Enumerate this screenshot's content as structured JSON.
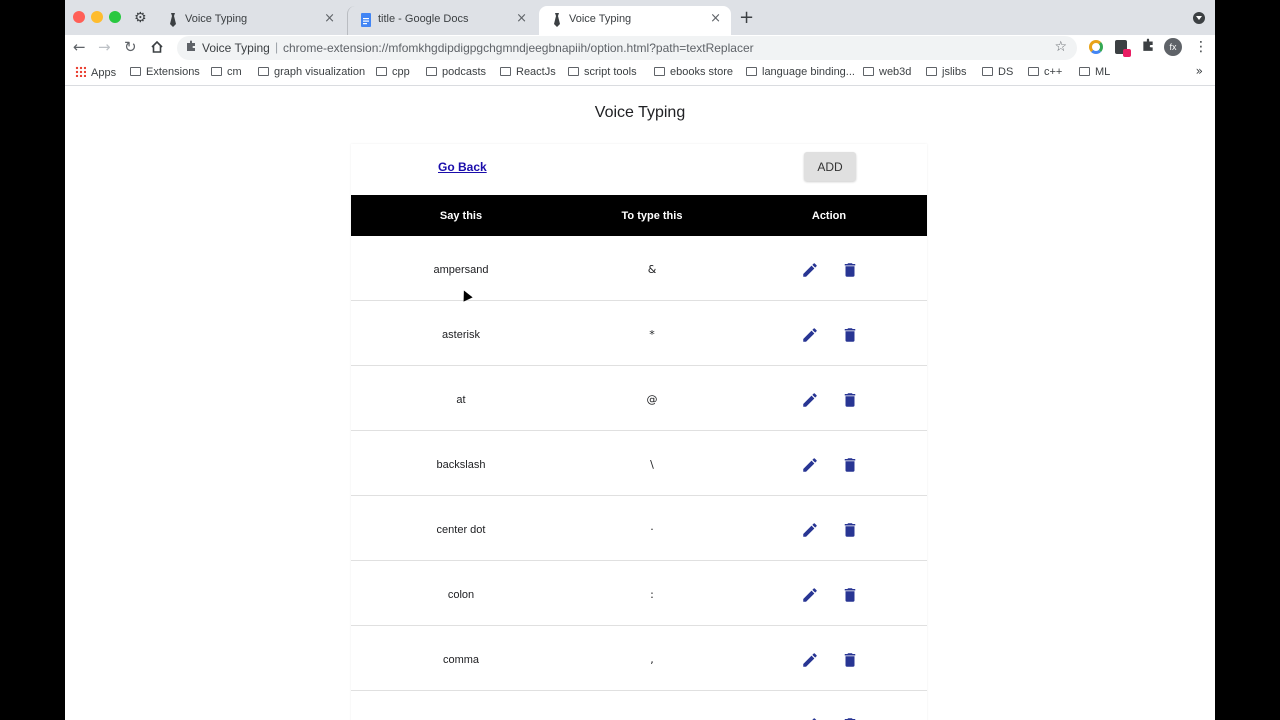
{
  "tabs": [
    {
      "title": "Voice Typing",
      "active": false
    },
    {
      "title": "title - Google Docs",
      "active": false
    },
    {
      "title": "Voice Typing",
      "active": true
    }
  ],
  "omnibox": {
    "site_label": "Voice Typing",
    "url": "chrome-extension://mfomkhgdipdigpgchgmndjeegbnapiih/option.html?path=textReplacer"
  },
  "profile_initials": "fx",
  "bookmarks": [
    "Apps",
    "Extensions",
    "cm",
    "graph visualization",
    "cpp",
    "podcasts",
    "ReactJs",
    "script tools",
    "ebooks store",
    "language binding...",
    "web3d",
    "jslibs",
    "DS",
    "c++",
    "ML"
  ],
  "page": {
    "title": "Voice Typing",
    "go_back": "Go Back",
    "add_label": "ADD",
    "columns": [
      "Say this",
      "To type this",
      "Action"
    ],
    "rows": [
      {
        "say": "ampersand",
        "type": "&"
      },
      {
        "say": "asterisk",
        "type": "*"
      },
      {
        "say": "at",
        "type": "@"
      },
      {
        "say": "backslash",
        "type": "\\"
      },
      {
        "say": "center dot",
        "type": "·"
      },
      {
        "say": "colon",
        "type": ":"
      },
      {
        "say": "comma",
        "type": ","
      },
      {
        "say": "",
        "type": ""
      }
    ]
  },
  "colors": {
    "accent": "#283593",
    "header_bg": "#000000",
    "tabstrip": "#dee1e6"
  }
}
